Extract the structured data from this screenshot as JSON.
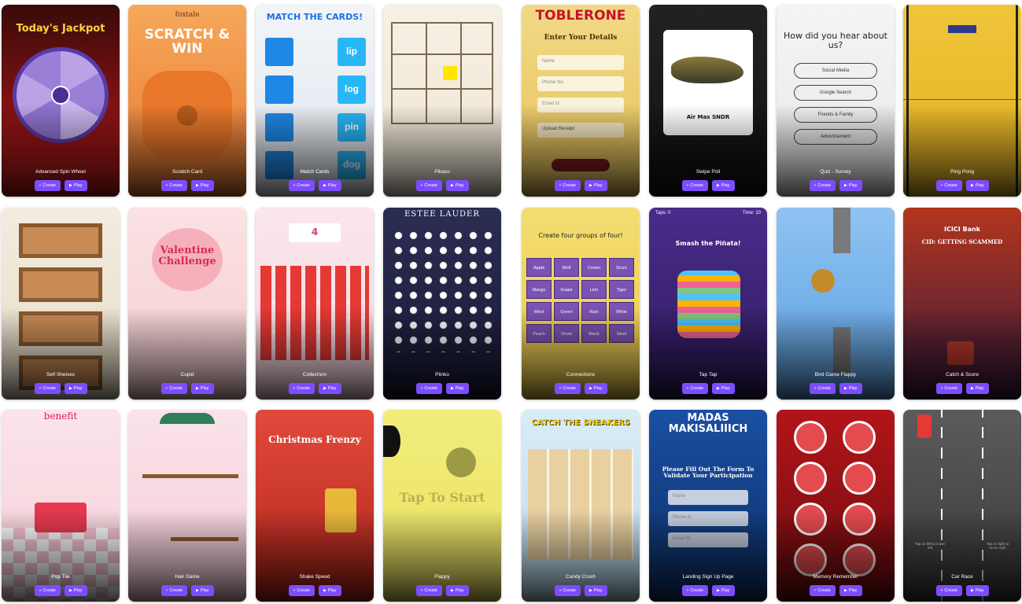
{
  "buttons": {
    "create": "Create",
    "play": "Play"
  },
  "icons": {
    "create": "plus-icon",
    "play": "play-icon"
  },
  "accent": "#7c4dff",
  "cards": [
    {
      "id": "advanced-spin-wheel",
      "name": "Advanced Spin Wheel",
      "headline": "Today's Jackpot",
      "bg": [
        "#3a0a0a",
        "#c21a1a"
      ],
      "headline_color": "#ffd23f"
    },
    {
      "id": "scratch-card",
      "name": "Scratch Card",
      "headline": "SCRATCH & WIN",
      "brand": "foxtale",
      "bg": [
        "#f6a85b",
        "#e7772f"
      ],
      "headline_color": "#ffffff"
    },
    {
      "id": "match-cards",
      "name": "Match Cards",
      "headline": "MATCH THE CARDS!",
      "bg": [
        "#f2f5f8",
        "#dfe6ee"
      ],
      "headline_color": "#1a73e8",
      "words": [
        "lip",
        "log",
        "pin",
        "dog"
      ]
    },
    {
      "id": "pikaso",
      "name": "Pikaso",
      "headline": "",
      "bg": [
        "#f6f0e4",
        "#efe6d4"
      ],
      "headline_color": "#333333"
    },
    {
      "id": "toblerone-form",
      "name": "",
      "headline": "TOBLERONE",
      "subheadline": "Enter Your Details",
      "bg": [
        "#f1d985",
        "#e6c15a"
      ],
      "headline_color": "#c8102e",
      "fields": [
        "Name",
        "Phone No.",
        "Email Id"
      ],
      "upload": "Upload Receipt"
    },
    {
      "id": "swipe-poll",
      "name": "Swipe Poll",
      "headline": "Air Max SNDR",
      "bg": [
        "#222222",
        "#111111"
      ],
      "headline_color": "#111111"
    },
    {
      "id": "quiz-survey",
      "name": "Quiz - Survey",
      "headline": "How did you hear about us?",
      "bg": [
        "#f4f4f4",
        "#e8e8e8"
      ],
      "headline_color": "#222222",
      "options": [
        "Social Media",
        "Google Search",
        "Friends & Family",
        "Advertisement"
      ]
    },
    {
      "id": "ping-pong",
      "name": "Ping Pong",
      "headline": "",
      "bg": [
        "#f0c53a",
        "#e2b021"
      ],
      "headline_color": "#222222"
    },
    {
      "id": "self-shelves",
      "name": "Self Shelves",
      "headline": "",
      "bg": [
        "#f3ece0",
        "#e8dcc6"
      ],
      "headline_color": "#222222"
    },
    {
      "id": "cupid",
      "name": "Cupid",
      "headline": "Valentine Challenge",
      "bg": [
        "#fbe2e4",
        "#f6cdd0"
      ],
      "headline_color": "#d62d4e"
    },
    {
      "id": "collect-em",
      "name": "Collect'em",
      "headline": "4",
      "bg": [
        "#fbe6ec",
        "#f8d7e0"
      ],
      "headline_color": "#e23a6b"
    },
    {
      "id": "plinko",
      "name": "Plinko",
      "headline": "ESTEE LAUDER",
      "bg": [
        "#2b2d52",
        "#1a1b36"
      ],
      "headline_color": "#ffffff"
    },
    {
      "id": "connections",
      "name": "Connections",
      "headline": "Create four groups of four!",
      "bg": [
        "#f3dd72",
        "#ecc94b"
      ],
      "headline_color": "#222222",
      "tiles": [
        "Apple",
        "Wolf",
        "Crown",
        "Drum",
        "Mango",
        "Grape",
        "Lion",
        "Tiger",
        "Wind",
        "Green",
        "Rain",
        "White",
        "Peach",
        "Snow",
        "Black",
        "Steel"
      ]
    },
    {
      "id": "tap-tap",
      "name": "Tap Tap",
      "headline": "Smash the Piñata!",
      "bg": [
        "#4a2c8a",
        "#2e1a5f"
      ],
      "headline_color": "#ffffff",
      "score_left": "Taps: 0",
      "score_right": "Time: 10"
    },
    {
      "id": "bird-game",
      "name": "Bird Game Flappy",
      "headline": "",
      "bg": [
        "#8fc3f2",
        "#5b9fe0"
      ],
      "headline_color": "#ffffff"
    },
    {
      "id": "catch-and-score",
      "name": "Catch & Score",
      "headline": "ICICI Bank",
      "subheadline": "CID: GETTING SCAMMED",
      "bg": [
        "#b2361e",
        "#3b1a3d"
      ],
      "headline_color": "#ffffff"
    },
    {
      "id": "pop-tile",
      "name": "Pop Tile",
      "headline": "benefit",
      "bg": [
        "#fbe4ea",
        "#f7cfd9"
      ],
      "headline_color": "#d81b60"
    },
    {
      "id": "hair-game",
      "name": "Hair Game",
      "headline": "",
      "bg": [
        "#fbe3ea",
        "#f4cbd6"
      ],
      "headline_color": "#222222"
    },
    {
      "id": "christmas-frenzy",
      "name": "Shake Speed",
      "headline": "Christmas Frenzy",
      "bg": [
        "#e14a3c",
        "#b3241a"
      ],
      "headline_color": "#ffffff"
    },
    {
      "id": "tap-to-start",
      "name": "Flappy",
      "headline": "Tap To Start",
      "bg": [
        "#f2ed7c",
        "#e8e160"
      ],
      "headline_color": "#b8b054"
    },
    {
      "id": "catch-sneakers",
      "name": "Candy Crush",
      "headline": "CATCH THE SNEAKERS",
      "bg": [
        "#d8ecf6",
        "#bedcf0"
      ],
      "headline_color": "#ffd400"
    },
    {
      "id": "madas-form",
      "name": "Landing Sign Up Page",
      "headline": "MADAS MAKISALIIICH",
      "subheadline": "Please Fill Out The Form To Validate Your Participation",
      "bg": [
        "#1a4fa3",
        "#0d2f66"
      ],
      "headline_color": "#ffffff",
      "fields": [
        "Name",
        "Phone N.",
        "Email ID"
      ]
    },
    {
      "id": "memory-remember",
      "name": "Memory Remember",
      "headline": "",
      "bg": [
        "#b3151a",
        "#6d0b0e"
      ],
      "headline_color": "#ffffff"
    },
    {
      "id": "car-race",
      "name": "Car Race",
      "headline": "",
      "bg": [
        "#5b5b5b",
        "#3a3a3a"
      ],
      "headline_color": "#ffffff",
      "hint_left": "Tap on left to move left",
      "hint_right": "Tap on right to move right"
    }
  ]
}
